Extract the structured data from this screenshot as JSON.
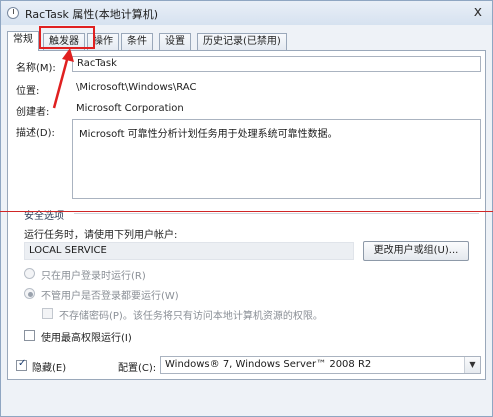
{
  "window": {
    "title": "RacTask 属性(本地计算机)",
    "close": "x"
  },
  "tabs": [
    "常规",
    "触发器",
    "操作",
    "条件",
    "设置",
    "历史记录(已禁用)"
  ],
  "general": {
    "name_label": "名称(M):",
    "name_value": "RacTask",
    "location_label": "位置:",
    "location_value": "\\Microsoft\\Windows\\RAC",
    "author_label": "创建者:",
    "author_value": "Microsoft Corporation",
    "description_label": "描述(D):",
    "description_value": "Microsoft 可靠性分析计划任务用于处理系统可靠性数据。"
  },
  "security": {
    "group_label": "安全选项",
    "run_as_label": "运行任务时，请使用下列用户帐户:",
    "account_value": "LOCAL SERVICE",
    "change_button": "更改用户或组(U)...",
    "radio_logged_on": "只在用户登录时运行(R)",
    "radio_whether": "不管用户是否登录都要运行(W)",
    "no_store_password": "不存储密码(P)。该任务将只有访问本地计算机资源的权限。",
    "highest_privileges": "使用最高权限运行(I)"
  },
  "bottom": {
    "hidden_label": "隐藏(E)",
    "hidden_checked": true,
    "configure_label": "配置(C):",
    "configure_value": "Windows® 7, Windows Server™ 2008 R2"
  },
  "colors": {
    "annotation": "#e02020"
  }
}
